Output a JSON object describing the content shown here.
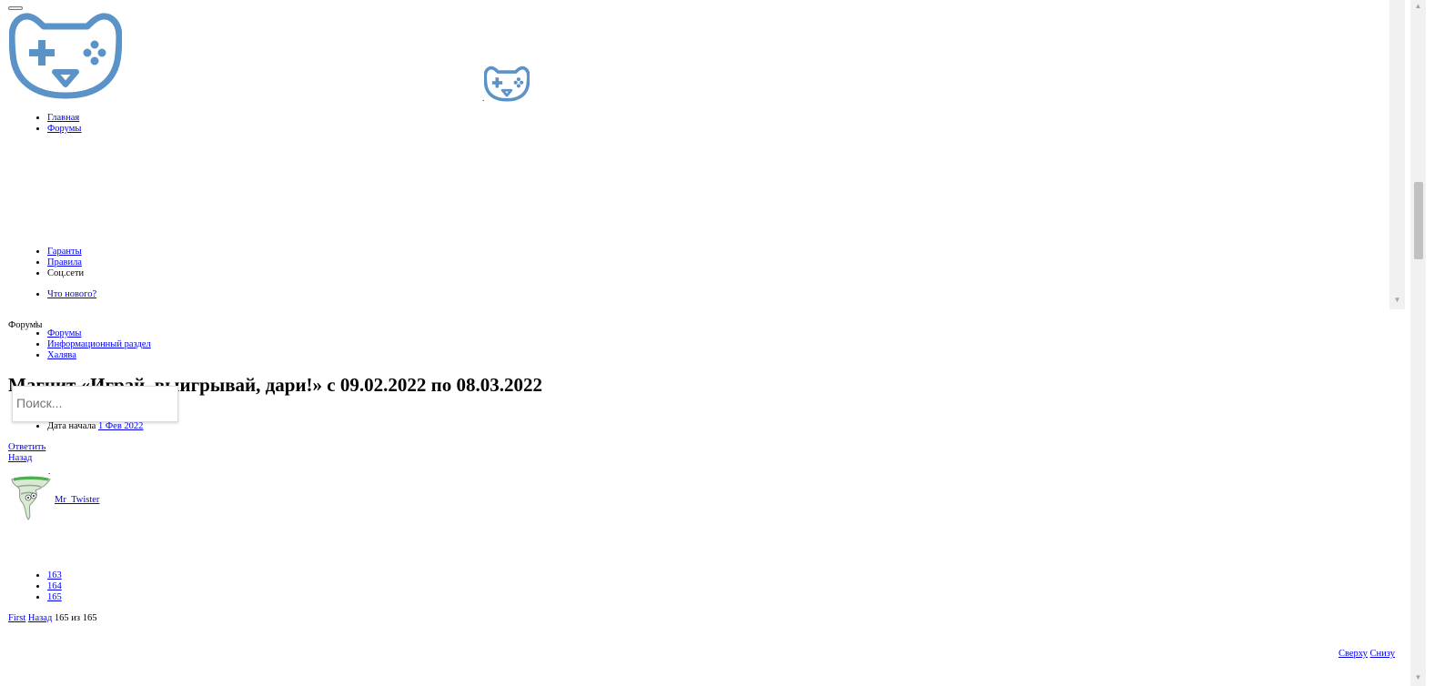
{
  "header": {
    "logo_dot": "."
  },
  "nav_primary": [
    {
      "label": "Главная"
    },
    {
      "label": "Форумы"
    }
  ],
  "nav_secondary": [
    {
      "label": "Гаранты",
      "link": true
    },
    {
      "label": "Правила",
      "link": true
    },
    {
      "label": "Соц.сети",
      "link": false
    }
  ],
  "nav_whats_new": {
    "label": "Что нового?"
  },
  "breadcrumb": {
    "heading": "Форумы",
    "items": [
      {
        "label": "Форумы"
      },
      {
        "label": "Информационный раздел"
      },
      {
        "label": "Халява"
      }
    ]
  },
  "thread": {
    "title": "Магнит «Играй, выигрывай, дари!» с 09.02.2022 по 08.03.2022",
    "start_label": "Дата начала",
    "start_date": "1 Фев 2022",
    "reply_label": "Ответить",
    "back_label": "Назад",
    "author_dot": ".",
    "author": "Mr_Twister"
  },
  "search": {
    "placeholder": "Поиск..."
  },
  "pagination": {
    "pages": [
      "163",
      "164",
      "165"
    ],
    "first_label": "First",
    "prev_label": "Назад",
    "status": "165 из 165"
  },
  "footer_links": {
    "top_label": "Сверху",
    "bottom_label": "Снизу"
  },
  "colors": {
    "logo": "#5b93c8",
    "link": "#0000ee"
  }
}
